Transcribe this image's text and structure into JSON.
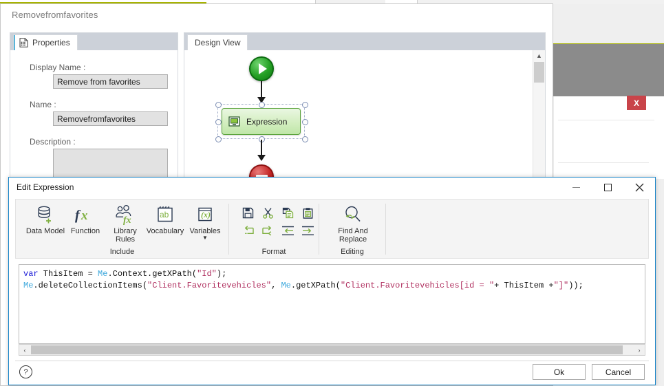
{
  "background": {
    "close_x_label": "X",
    "accent_olive": "#a8b400",
    "gray_band": "#8b8b8b"
  },
  "back_window": {
    "title": "Removefromfavorites",
    "properties_panel": {
      "tab_label": "Properties",
      "tab_icon": "properties-icon",
      "fields": [
        {
          "label": "Display Name :",
          "value": "Remove from favorites"
        },
        {
          "label": "Name :",
          "value": "Removefromfavorites"
        },
        {
          "label": "Description :",
          "value": ""
        }
      ]
    },
    "design_panel": {
      "tab_label": "Design View",
      "nodes": {
        "start": "start-node",
        "expression": "Expression",
        "stop": "stop-node"
      }
    }
  },
  "edit_dialog": {
    "title": "Edit Expression",
    "window_buttons": {
      "minimize": "minimize-icon",
      "maximize": "maximize-icon",
      "close": "close-icon"
    },
    "ribbon": {
      "groups": [
        {
          "name": "Include",
          "label": "Include",
          "buttons": [
            {
              "label": "Data Model",
              "icon": "database-add-icon"
            },
            {
              "label": "Function",
              "icon": "fx-icon"
            },
            {
              "label": "Library Rules",
              "icon": "library-rules-icon"
            },
            {
              "label": "Vocabulary",
              "icon": "vocabulary-icon"
            },
            {
              "label": "Variables",
              "icon": "variables-icon",
              "has_dropdown": true
            }
          ]
        },
        {
          "name": "Format",
          "label": "Format",
          "buttons": [
            {
              "label": "Save",
              "icon": "save-icon"
            },
            {
              "label": "Cut",
              "icon": "cut-icon"
            },
            {
              "label": "Copy",
              "icon": "copy-icon"
            },
            {
              "label": "Paste",
              "icon": "paste-icon"
            },
            {
              "label": "Undo",
              "icon": "undo-icon"
            },
            {
              "label": "Redo",
              "icon": "redo-icon"
            },
            {
              "label": "Outdent",
              "icon": "outdent-icon"
            },
            {
              "label": "Indent",
              "icon": "indent-icon"
            }
          ]
        },
        {
          "name": "Editing",
          "label": "Editing",
          "buttons": [
            {
              "label": "Find And Replace",
              "icon": "find-replace-icon"
            }
          ]
        }
      ]
    },
    "code": {
      "line1": {
        "kw": "var",
        "name": " ThisItem = ",
        "obj": "Me",
        "rest1": ".Context.getXPath(",
        "str1": "\"Id\"",
        "rest2": ");"
      },
      "line2": {
        "obj1": "Me",
        "part1": ".deleteCollectionItems(",
        "str1": "\"Client.Favoritevehicles\"",
        "part2": ", ",
        "obj2": "Me",
        "part3": ".getXPath(",
        "str2": "\"Client.Favoritevehicles[id = \"",
        "part4": "+ ThisItem +",
        "str3": "\"]\"",
        "part5": "));"
      },
      "plain_line1": "var ThisItem = Me.Context.getXPath(\"Id\");",
      "plain_line2": "Me.deleteCollectionItems(\"Client.Favoritevehicles\", Me.getXPath(\"Client.Favoritevehicles[id = \"+ ThisItem +\"]\"));"
    },
    "footer": {
      "help_glyph": "?",
      "ok_label": "Ok",
      "cancel_label": "Cancel"
    },
    "scroll": {
      "left_arrow": "‹",
      "right_arrow": "›"
    }
  }
}
